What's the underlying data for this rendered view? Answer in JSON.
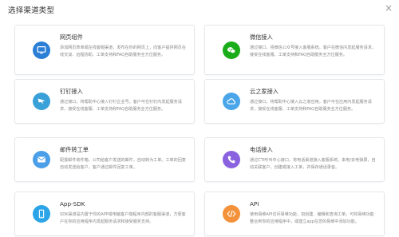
{
  "dialog": {
    "title": "选择渠道类型",
    "close_symbol": "×"
  },
  "colors": {
    "web": "#2b7fd6",
    "wechat": "#1aad19",
    "dingtalk": "#3aa0d8",
    "cloud": "#4aa6e8",
    "email": "#4a9fe8",
    "phone": "#8a62e0",
    "sdk": "#2ba4e8",
    "api": "#f3923a"
  },
  "channels": [
    {
      "id": "web",
      "title": "网页组件",
      "icon": "monitor-icon",
      "description": "添加网页表单或在线客服渠道，发布在你的网页上，向客户提供网页在线交谈、远程协助、工单支持和FAQ自助服务全方位服务。"
    },
    {
      "id": "wechat",
      "title": "微信接入",
      "icon": "wechat-icon",
      "description": "通过接口，将微信公众号接入客服系统。客户在微信内发起服务请求，接受在线客服、工单支持和FAQ自助服务全方位服务。"
    },
    {
      "id": "dingtalk",
      "title": "钉钉接入",
      "icon": "dingtalk-icon",
      "description": "通过接口，将帮助中心接入钉钉企业号。客户可在钉钉内发起服务请求，接受在线客服、工单支持和FAQ自助服务全方位服务。"
    },
    {
      "id": "cloud",
      "title": "云之家接入",
      "icon": "cloud-icon",
      "description": "通过接口，将帮助中心接入云之家应用。客户可在应用内发起服务请求，接受在线客服、工单支持和FAQ自助服务全方位服务。"
    },
    {
      "id": "email",
      "title": "邮件转工单",
      "icon": "mail-icon",
      "description": "配置邮件收件箱，公司给客户发送的邮件，自动转为工单。工单的回复自动发送给客户，客户通过邮件回复工单。"
    },
    {
      "id": "phone",
      "title": "电话接入",
      "icon": "phone-icon",
      "description": "通过CTI呼叫中心接口，将电话渠道接入客服系统。来电/去电弹屏，自动关联客户，创建或接入工单，并保存通话录音。"
    },
    {
      "id": "sdk",
      "title": "App-SDK",
      "icon": "mobile-icon",
      "description": "SDK渠道是内置于你的APP或电脑客户端程序内部的客服渠道，方便客户在你的应用程序内发起服务请求和接受服务支持。"
    },
    {
      "id": "api",
      "title": "API",
      "icon": "code-icon",
      "description": "使用易维API访问易维功能，如创建、编辑和查询工单。可将易维功能整合到你的应用程序中，或建立app在您的易维中添加功能。"
    }
  ]
}
